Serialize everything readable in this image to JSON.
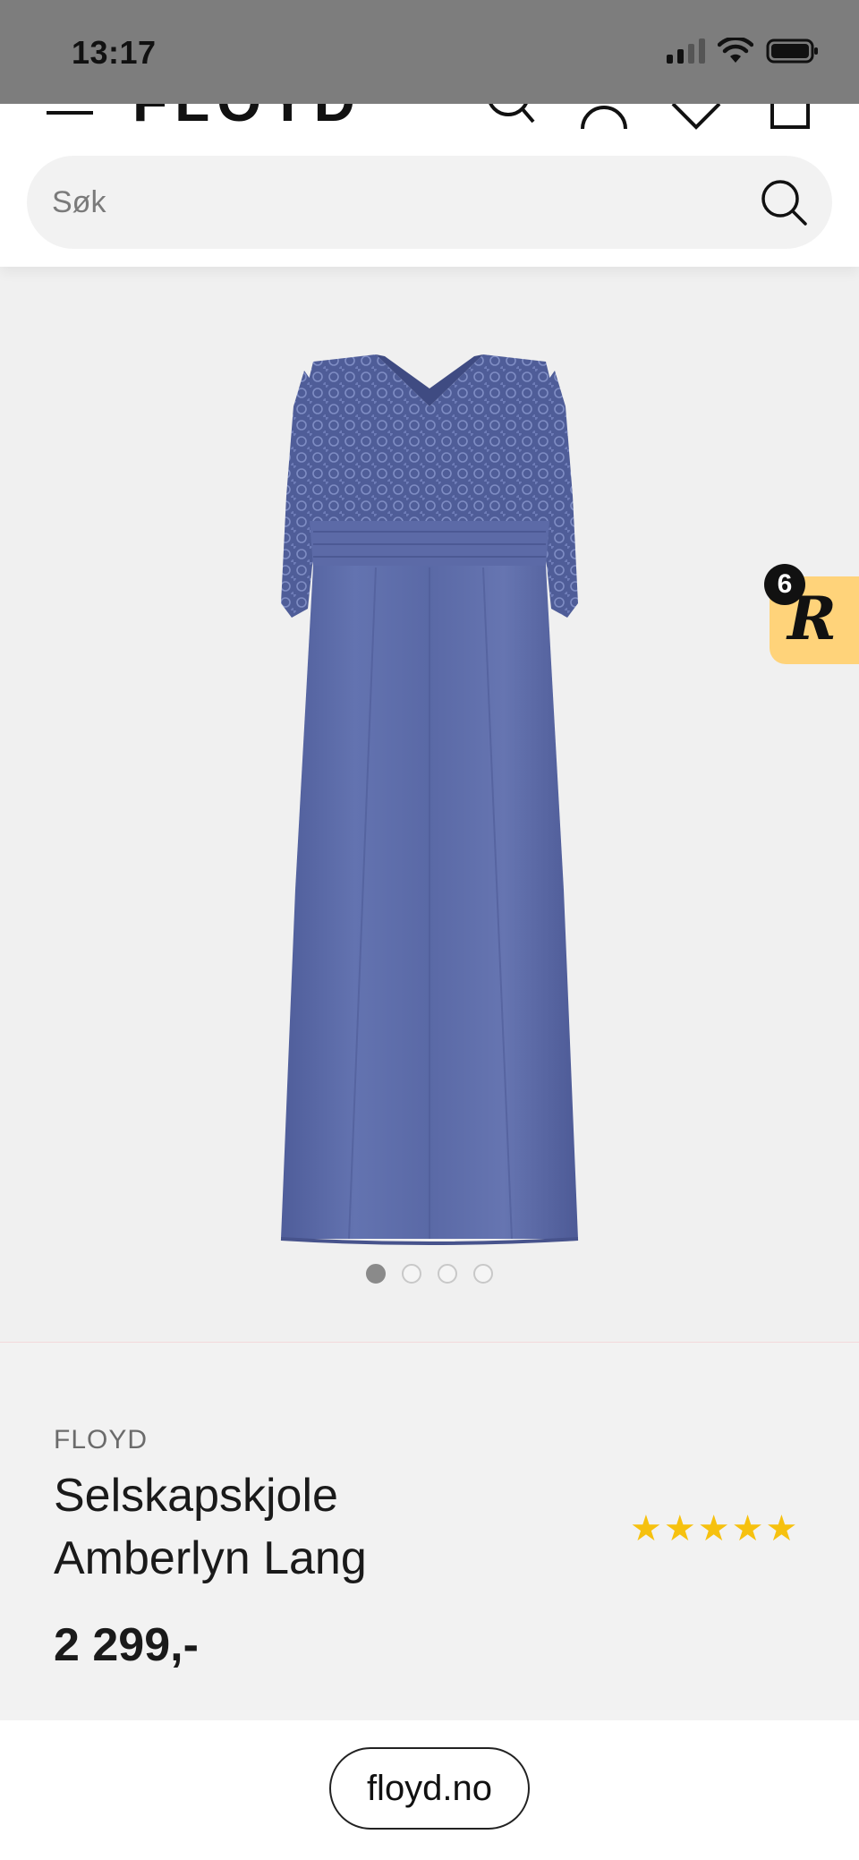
{
  "status_bar": {
    "time": "13:17"
  },
  "header": {
    "logo": "FLOYD",
    "icons": [
      "menu-icon",
      "search-icon",
      "account-icon",
      "heart-icon",
      "bag-icon"
    ]
  },
  "search": {
    "placeholder": "Søk"
  },
  "gallery": {
    "image_count": 4,
    "active_index": 0,
    "dress_color": "#5b6aa6"
  },
  "reviews_badge": {
    "count": "6",
    "letter": "R"
  },
  "product": {
    "brand": "FLOYD",
    "title_line1": "Selskapskjole",
    "title_line2": "Amberlyn Lang",
    "price": "2 299,-",
    "rating": 5
  },
  "browser": {
    "url": "floyd.no"
  },
  "colors": {
    "star": "#f6c10f",
    "badge": "#ffd37a",
    "status_bar": "#7d7d7d"
  }
}
